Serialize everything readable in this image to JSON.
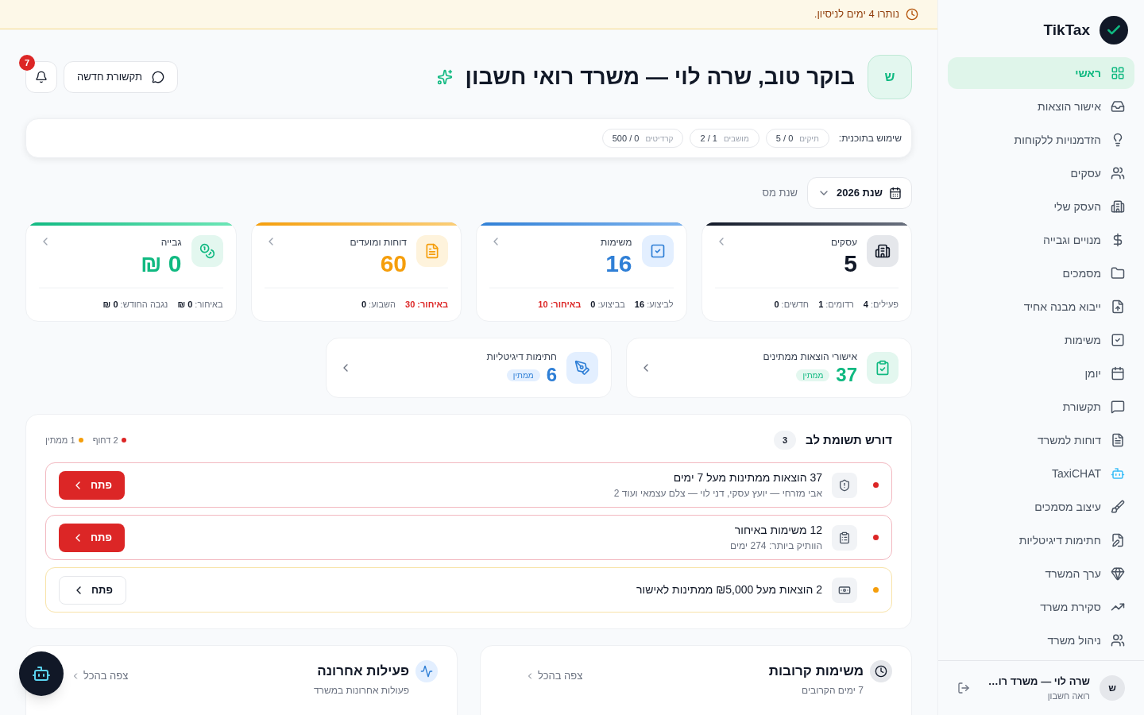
{
  "trial_banner": {
    "text": "נותרו 4 ימים לניסיון."
  },
  "sidebar": {
    "brand": "TikTax",
    "items": [
      {
        "label": "ראשי",
        "selected": true
      },
      {
        "label": "אישור הוצאות",
        "selected": false
      },
      {
        "label": "הזדמנויות ללקוחות",
        "selected": false
      },
      {
        "label": "עסקים",
        "selected": false
      },
      {
        "label": "העסק שלי",
        "selected": false
      },
      {
        "label": "מנויים וגבייה",
        "selected": false
      },
      {
        "label": "מסמכים",
        "selected": false
      },
      {
        "label": "ייבוא מבנה אחיד",
        "selected": false
      },
      {
        "label": "משימות",
        "selected": false
      },
      {
        "label": "יומן",
        "selected": false
      },
      {
        "label": "תקשורת",
        "selected": false
      },
      {
        "label": "דוחות למשרד",
        "selected": false
      },
      {
        "label": "TaxiCHAT",
        "selected": false
      },
      {
        "label": "עיצוב מסמכים",
        "selected": false
      },
      {
        "label": "חתימות דיגיטליות",
        "selected": false
      },
      {
        "label": "ערך המשרד",
        "selected": false
      },
      {
        "label": "סקירת משרד",
        "selected": false
      },
      {
        "label": "ניהול משרד",
        "selected": false
      }
    ],
    "user": {
      "avatar": "ש",
      "name": "שרה לוי — משרד רו…",
      "role": "רואה חשבון"
    }
  },
  "header": {
    "avatar": "ש",
    "title": "בוקר טוב, שרה לוי — משרד רואי חשבון",
    "new_message": "תקשורת חדשה",
    "notifications": "7"
  },
  "usage": {
    "label": "שימוש בתוכנית:",
    "items": [
      {
        "name": "תיקים",
        "value": "0 / 5"
      },
      {
        "name": "מושבים",
        "value": "1 / 2"
      },
      {
        "name": "קרדיטים",
        "value": "0 / 500"
      }
    ]
  },
  "tax_year": {
    "label": "שנת מס",
    "value": "שנת 2026"
  },
  "stat_cards": [
    {
      "title": "עסקים",
      "value": "5",
      "color": "#111827",
      "stats": [
        {
          "label": "פעילים:",
          "value": "4",
          "alert": false
        },
        {
          "label": "רדומים:",
          "value": "1",
          "alert": false
        },
        {
          "label": "חדשים:",
          "value": "0",
          "alert": false
        }
      ]
    },
    {
      "title": "משימות",
      "value": "16",
      "color": "#2f7fd6",
      "stats": [
        {
          "label": "לביצוע:",
          "value": "16",
          "alert": false
        },
        {
          "label": "בביצוע:",
          "value": "0",
          "alert": false
        },
        {
          "label": "באיחור:",
          "value": "10",
          "alert": true
        }
      ]
    },
    {
      "title": "דוחות ומועדים",
      "value": "60",
      "color": "#f59e0b",
      "stats": [
        {
          "label": "באיחור:",
          "value": "30",
          "alert": true
        },
        {
          "label": "השבוע:",
          "value": "0",
          "alert": false
        }
      ]
    },
    {
      "title": "גבייה",
      "value": "0 ₪",
      "color": "#10b981",
      "stats": [
        {
          "label": "באיחור:",
          "value": "0 ₪",
          "alert": false
        },
        {
          "label": "נגבה החודש:",
          "value": "0 ₪",
          "alert": false
        }
      ]
    }
  ],
  "pending_cards": [
    {
      "title": "אישורי הוצאות ממתינים",
      "value": "37",
      "badge": "ממתין",
      "color": "#10b981"
    },
    {
      "title": "חתימות דיגיטליות",
      "value": "6",
      "badge": "ממתין",
      "color": "#2f7fd6"
    }
  ],
  "attention": {
    "title": "דורש תשומת לב",
    "count": "3",
    "legend": [
      {
        "text": "2 דחוף",
        "color": "#dc2626"
      },
      {
        "text": "1 ממתין",
        "color": "#f59e0b"
      }
    ],
    "items": [
      {
        "kind": "urgent",
        "color": "#dc2626",
        "title": "37 הוצאות ממתינות מעל 7 ימים",
        "subtitle": "אבי מזרחי — יועץ עסקי, דני לוי — צלם עצמאי ועוד 2",
        "button": "פתח"
      },
      {
        "kind": "urgent",
        "color": "#dc2626",
        "title": "12 משימות באיחור",
        "subtitle": "הוותיק ביותר: 274 ימים",
        "button": "פתח"
      },
      {
        "kind": "pending",
        "color": "#f59e0b",
        "title": "2 הוצאות מעל ₪5,000 ממתינות לאישור",
        "button": "פתח"
      }
    ]
  },
  "bottom_cards": [
    {
      "title": "משימות קרובות",
      "subtitle": "7 ימים הקרובים",
      "link": "צפה בהכל"
    },
    {
      "title": "פעילות אחרונה",
      "subtitle": "פעולות אחרונות במשרד",
      "link": "צפה בהכל"
    }
  ]
}
